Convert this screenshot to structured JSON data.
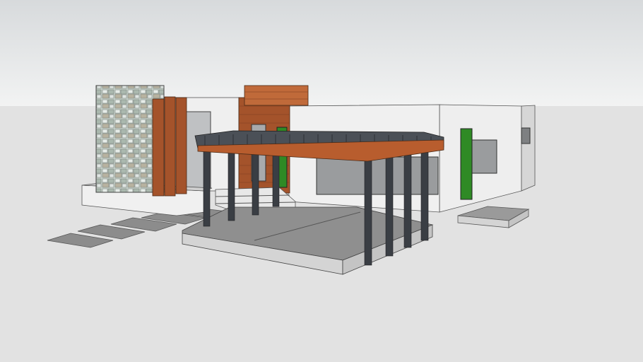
{
  "scene": {
    "type": "3d-model-render",
    "colors": {
      "sky_top": "#d7dadc",
      "sky_horizon": "#f2f3f3",
      "ground": "#e2e2e2",
      "wall_white": "#f0f0f0",
      "wall_shade": "#d9d9d9",
      "wood": "#a4532b",
      "wood_light": "#c06a3a",
      "pergola_slats": "#4b5057",
      "column": "#3a3e44",
      "slab_top": "#8f8f8f",
      "slab_face": "#d4d4d4",
      "window": "#9a9c9e",
      "door_green": "#2f8a25",
      "stone": "#c9d3cc"
    }
  }
}
